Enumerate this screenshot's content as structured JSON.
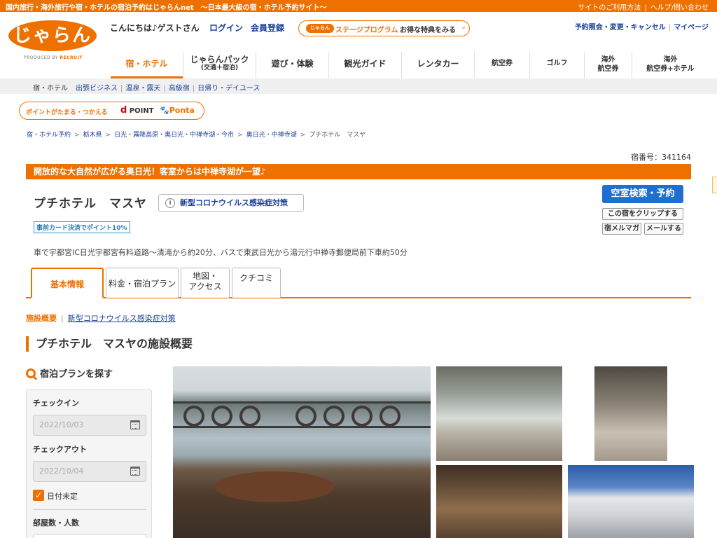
{
  "topbar": {
    "tagline": "国内旅行・海外旅行や宿・ホテルの宿泊予約はじゃらんnet　〜日本最大級の宿・ホテル予約サイト〜",
    "links": [
      "サイトのご利用方法",
      "ヘルプ/問い合わせ"
    ]
  },
  "header": {
    "logo": "じゃらん",
    "logo_sub": "PRODUCED BY",
    "logo_brand": "RECRUIT",
    "greeting": "こんにちは♪ゲストさん",
    "login": "ログイン",
    "register": "会員登録",
    "stage_pill": "じゃらん",
    "stage_name": "ステージプログラム",
    "stage_benefit": "お得な特典をみる",
    "right_links": [
      "予約照会・変更・キャンセル",
      "マイページ"
    ]
  },
  "gnav": [
    {
      "l1": "宿・ホテル",
      "l2": "",
      "active": true
    },
    {
      "l1": "じゃらんパック",
      "l2": "(交通＋宿泊)"
    },
    {
      "l1": "遊び・体験",
      "l2": ""
    },
    {
      "l1": "観光ガイド",
      "l2": ""
    },
    {
      "l1": "レンタカー",
      "l2": ""
    },
    {
      "l1": "航空券",
      "l2": ""
    },
    {
      "l1": "ゴルフ",
      "l2": ""
    },
    {
      "l1": "海外",
      "l2": "航空券"
    },
    {
      "l1": "海外",
      "l2": "航空券+ホテル"
    }
  ],
  "subnav": {
    "current": "宿・ホテル",
    "links": [
      "出張ビジネス",
      "温泉・露天",
      "高級宿",
      "日帰り・デイユース"
    ]
  },
  "points": {
    "text": "ポイントがたまる・つかえる",
    "dpoint_mark": "d",
    "dpoint": "POINT",
    "ponta": "Ponta"
  },
  "breadcrumb": [
    "宿・ホテル予約",
    "栃木県",
    "日光・霧降高原・奥日光・中禅寺湖・今市",
    "奥日光・中禅寺湖",
    "プチホテル　マスヤ"
  ],
  "hotel": {
    "number": "宿番号：341164",
    "catch": "開放的な大自然が広がる奥日光！客室からは中禅寺湖が一望♪",
    "name": "プチホテル　マスヤ",
    "covid_btn": "新型コロナウイルス感染症対策",
    "badge": "事前カード決済でポイント10%",
    "access": "車で宇都宮IC日光宇都宮有料道路〜清滝から約20分、バスで東武日光から湯元行中禅寺郵便局前下車約50分"
  },
  "actions": {
    "search": "空室検索・予約",
    "clip": "この宿をクリップする",
    "magazine": "宿メルマガ",
    "mail": "メールする"
  },
  "tabs": [
    {
      "l1": "基本情報",
      "l2": "",
      "active": true
    },
    {
      "l1": "料金・宿泊プラン",
      "l2": ""
    },
    {
      "l1": "地図・",
      "l2": "アクセス"
    },
    {
      "l1": "クチコミ",
      "l2": ""
    }
  ],
  "anchor": {
    "a1": "施設概要",
    "a2": "新型コロナウイルス感染症対策"
  },
  "section_title": "プチホテル　マスヤの施設概要",
  "plan_search": {
    "title": "宿泊プランを探す",
    "checkin_label": "チェックイン",
    "checkin_value": "2022/10/03",
    "checkout_label": "チェックアウト",
    "checkout_value": "2022/10/04",
    "undecided": "日付未定",
    "rooms_label": "部屋数・人数"
  }
}
